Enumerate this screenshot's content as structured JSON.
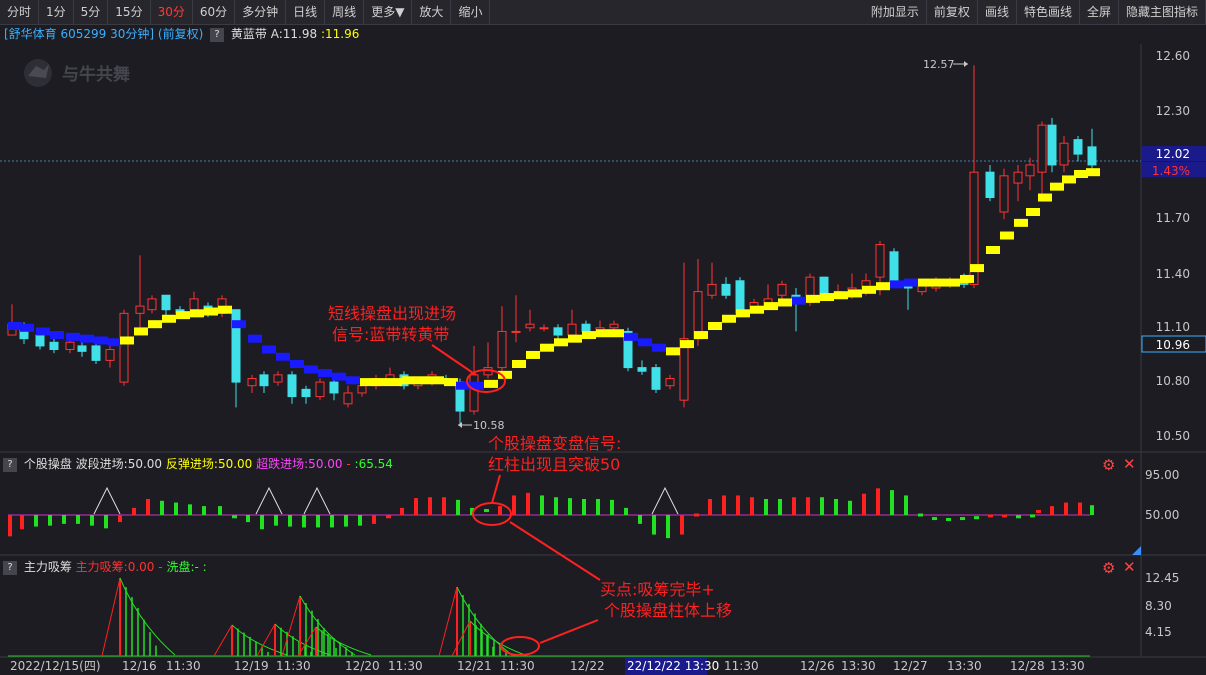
{
  "toolbar_left": [
    "分时",
    "1分",
    "5分",
    "15分",
    "30分",
    "60分",
    "多分钟",
    "日线",
    "周线",
    "更多▼",
    "放大",
    "缩小"
  ],
  "toolbar_active": "30分",
  "toolbar_right": [
    "附加显示",
    "前复权",
    "画线",
    "特色画线",
    "全屏",
    "隐藏主图指标"
  ],
  "stock": {
    "title": "[舒华体育 605299 30分钟] (前复权)",
    "indicator": "黄蓝带",
    "a_label": "A:11.98",
    "a_value": ":11.96"
  },
  "watermark": "与牛共舞",
  "price_axis": [
    "12.60",
    "12.30",
    "12.02",
    "11.70",
    "11.40",
    "11.10",
    "10.96",
    "10.80",
    "10.50"
  ],
  "current_price": {
    "price": "12.02",
    "pct": "1.43%",
    "marker": "10.96"
  },
  "annotations": {
    "high": "12.57",
    "low": "10.58",
    "note1_line1": "短线操盘出现进场",
    "note1_line2": "信号:蓝带转黄带",
    "note2_line1": "个股操盘变盘信号:",
    "note2_line2": "红柱出现且突破50",
    "note3_line1": "买点:吸筹完毕+",
    "note3_line2": "个股操盘柱体上移"
  },
  "panel2": {
    "name": "个股操盘",
    "wave": "波段进场:50.00",
    "rebound": "反弹进场:50.00",
    "oversold": "超跌进场:50.00",
    "dash": "-",
    "value": ":65.54",
    "axis": [
      "95.00",
      "50.00"
    ]
  },
  "panel3": {
    "name": "主力吸筹",
    "main": "主力吸筹:0.00",
    "dash": "-",
    "wash": "洗盘:-",
    "colon": ":",
    "axis": [
      "12.45",
      "8.30",
      "4.15"
    ]
  },
  "time_axis": [
    "2022/12/15(四)",
    "12/16",
    "11:30",
    "12/19",
    "11:30",
    "12/20",
    "11:30",
    "12/21",
    "11:30",
    "12/22",
    "22/12/22 13:30",
    "11:30",
    "12/26",
    "13:30",
    "12/27",
    "13:30",
    "12/28",
    "13:30"
  ],
  "colors": {
    "up": "#ff3333",
    "down": "#40e0e8",
    "yellow_band": "#ffff00",
    "blue_band": "#1a1aff",
    "annotation": "#ff2020",
    "line50": "#cc33cc"
  }
}
